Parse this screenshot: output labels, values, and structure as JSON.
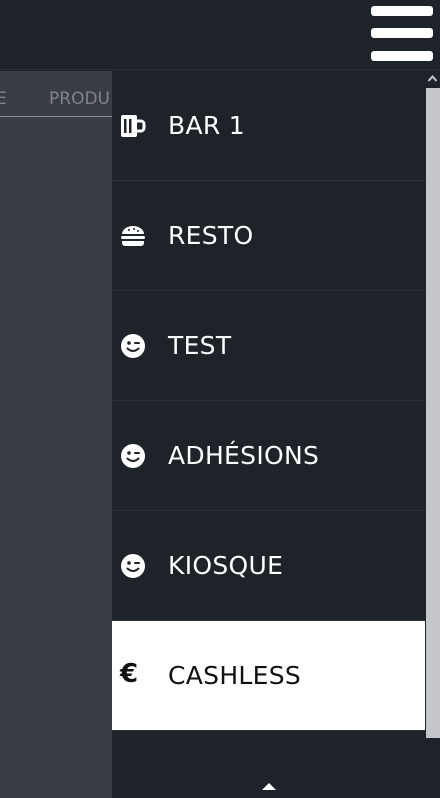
{
  "background_tabs": [
    "E",
    "PRODU"
  ],
  "menu": {
    "items": [
      {
        "label": "BAR 1",
        "icon": "beer-mug-icon",
        "active": false
      },
      {
        "label": "RESTO",
        "icon": "burger-icon",
        "active": false
      },
      {
        "label": "TEST",
        "icon": "wink-face-icon",
        "active": false
      },
      {
        "label": "ADHÉSIONS",
        "icon": "wink-face-icon",
        "active": false
      },
      {
        "label": "KIOSQUE",
        "icon": "wink-face-icon",
        "active": false
      },
      {
        "label": "CASHLESS",
        "icon": "euro-icon",
        "active": true
      }
    ],
    "euro_symbol": "€"
  },
  "colors": {
    "background": "#1e2229",
    "side_panel": "#373c45",
    "active_item": "#ffffff",
    "text": "#ffffff",
    "scroll_thumb": "#c5c7ca"
  }
}
